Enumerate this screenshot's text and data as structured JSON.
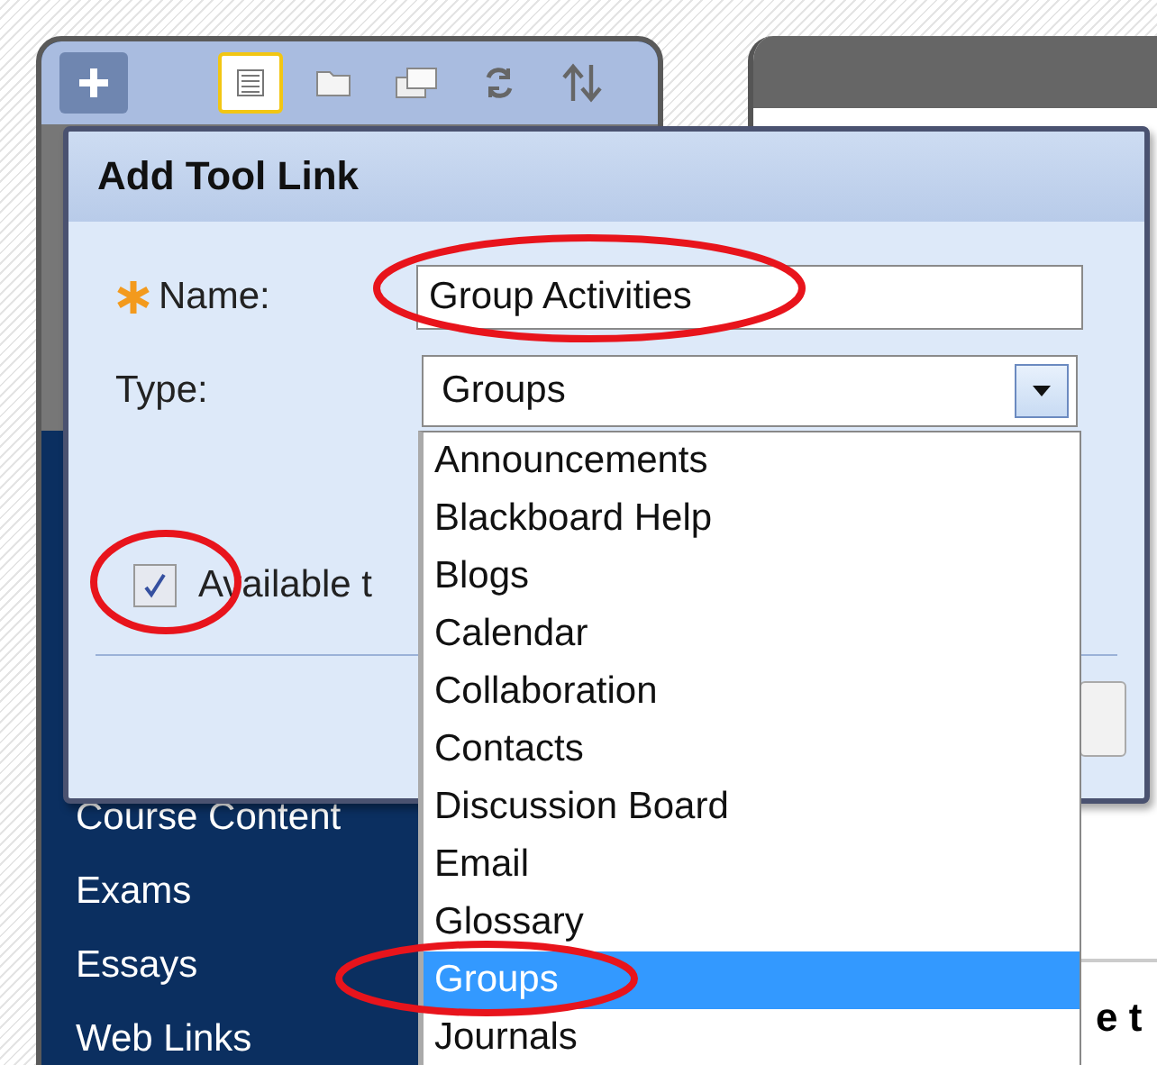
{
  "toolbar": {
    "tools": [
      {
        "kind": "list",
        "selected": true
      },
      {
        "kind": "folder",
        "selected": false
      },
      {
        "kind": "windows",
        "selected": false
      },
      {
        "kind": "refresh",
        "selected": false
      },
      {
        "kind": "sort",
        "selected": false
      }
    ]
  },
  "sidebar": {
    "items": [
      "Course Content",
      "Exams",
      "Essays",
      "Web Links"
    ]
  },
  "dialog": {
    "title": "Add Tool Link",
    "name": {
      "label": "Name:",
      "required": true,
      "value": "Group Activities"
    },
    "type": {
      "label": "Type:",
      "value": "Groups"
    },
    "available": {
      "label": "Available t",
      "checked": true
    }
  },
  "dropdown": {
    "options": [
      {
        "label": "Announcements",
        "selected": false
      },
      {
        "label": "Blackboard Help",
        "selected": false
      },
      {
        "label": "Blogs",
        "selected": false
      },
      {
        "label": "Calendar",
        "selected": false
      },
      {
        "label": "Collaboration",
        "selected": false
      },
      {
        "label": "Contacts",
        "selected": false
      },
      {
        "label": "Discussion Board",
        "selected": false
      },
      {
        "label": "Email",
        "selected": false
      },
      {
        "label": "Glossary",
        "selected": false
      },
      {
        "label": "Groups",
        "selected": true
      },
      {
        "label": "Journals",
        "selected": false
      }
    ]
  },
  "content_heading": "e t"
}
